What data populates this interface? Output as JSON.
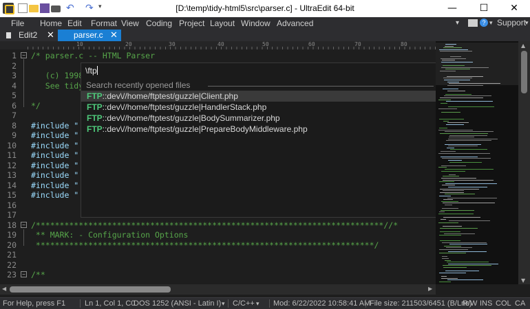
{
  "window": {
    "title": "[D:\\temp\\tidy-html5\\src\\parser.c] - UltraEdit 64-bit",
    "minimize": "—",
    "maximize": "☐",
    "close": "✕"
  },
  "quick_access": {
    "undo": "↶",
    "redo": "↷",
    "dropdown": "▾"
  },
  "menu": {
    "items": [
      "File",
      "Home",
      "Edit",
      "Format",
      "View",
      "Coding",
      "Project",
      "Layout",
      "Window",
      "Advanced"
    ],
    "support": "Support",
    "support_caret": "▾",
    "help": "?",
    "help_caret": "▾"
  },
  "tabs": [
    {
      "label": "Edit2",
      "close": "✕",
      "active": false
    },
    {
      "label": "parser.c",
      "close": "✕",
      "active": true
    }
  ],
  "ruler": {
    "labels": [
      "10",
      "20",
      "30",
      "40",
      "50",
      "60",
      "70",
      "80"
    ]
  },
  "editor": {
    "lines": [
      {
        "n": "1",
        "text": "/* parser.c -- HTML Parser",
        "fold": "−",
        "kind": "comment"
      },
      {
        "n": "2",
        "text": "",
        "kind": "plain"
      },
      {
        "n": "3",
        "text": "   (c) 1998",
        "kind": "comment"
      },
      {
        "n": "4",
        "text": "   See tidy",
        "kind": "comment"
      },
      {
        "n": "5",
        "text": "",
        "kind": "plain"
      },
      {
        "n": "6",
        "text": "*/",
        "kind": "comment"
      },
      {
        "n": "7",
        "text": "",
        "kind": "plain"
      },
      {
        "n": "8",
        "text": "#include \"",
        "kind": "pre"
      },
      {
        "n": "9",
        "text": "#include \"",
        "kind": "pre"
      },
      {
        "n": "10",
        "text": "#include \"",
        "kind": "pre"
      },
      {
        "n": "11",
        "text": "#include \"",
        "kind": "pre"
      },
      {
        "n": "12",
        "text": "#include \"",
        "kind": "pre"
      },
      {
        "n": "13",
        "text": "#include \"",
        "kind": "pre"
      },
      {
        "n": "14",
        "text": "#include \"",
        "kind": "pre"
      },
      {
        "n": "15",
        "text": "#include \"",
        "kind": "pre"
      },
      {
        "n": "16",
        "text": "",
        "kind": "plain"
      },
      {
        "n": "17",
        "text": "",
        "kind": "plain"
      },
      {
        "n": "18",
        "text": "/*************************************************************************//*",
        "fold": "−",
        "kind": "comment"
      },
      {
        "n": "19",
        "text": " ** MARK: - Configuration Options",
        "kind": "comment"
      },
      {
        "n": "20",
        "text": " ***********************************************************************/",
        "kind": "comment"
      },
      {
        "n": "21",
        "text": "",
        "kind": "plain"
      },
      {
        "n": "22",
        "text": "",
        "kind": "plain"
      },
      {
        "n": "23",
        "text": "/**",
        "fold": "−",
        "kind": "comment"
      }
    ]
  },
  "popup": {
    "input_value": "\\ftp",
    "header": "Search recently opened files",
    "close": "✕",
    "items": [
      {
        "proto": "FTP",
        "path": "::dev\\//home/ftptest/guzzle|Client.php"
      },
      {
        "proto": "FTP",
        "path": "::dev\\//home/ftptest/guzzle|HandlerStack.php"
      },
      {
        "proto": "FTP",
        "path": "::dev\\//home/ftptest/guzzle|BodySummarizer.php"
      },
      {
        "proto": "FTP",
        "path": "::dev\\//home/ftptest/guzzle|PrepareBodyMiddleware.php"
      }
    ],
    "selected_index": 0
  },
  "scrollbars": {
    "up": "▲",
    "down": "▼",
    "left": "◀",
    "right": "▶"
  },
  "status": {
    "help": "For Help, press F1",
    "position": "Ln 1, Col 1, C0",
    "line_ending": "DOS",
    "encoding": "1252  (ANSI - Latin I)",
    "encoding_caret": "▾",
    "language": "C/C++",
    "language_caret": "▾",
    "modified": "Mod: 6/22/2022 10:58:41 AM",
    "filesize": "File size: 211503/6451 (B/Lns)",
    "rw": "R/W",
    "ins": "INS",
    "col": "COL",
    "caps": "CA"
  },
  "colors": {
    "accent_tab": "#1a7fd4",
    "comment": "#57a64a",
    "ftp": "#4ec97a"
  }
}
